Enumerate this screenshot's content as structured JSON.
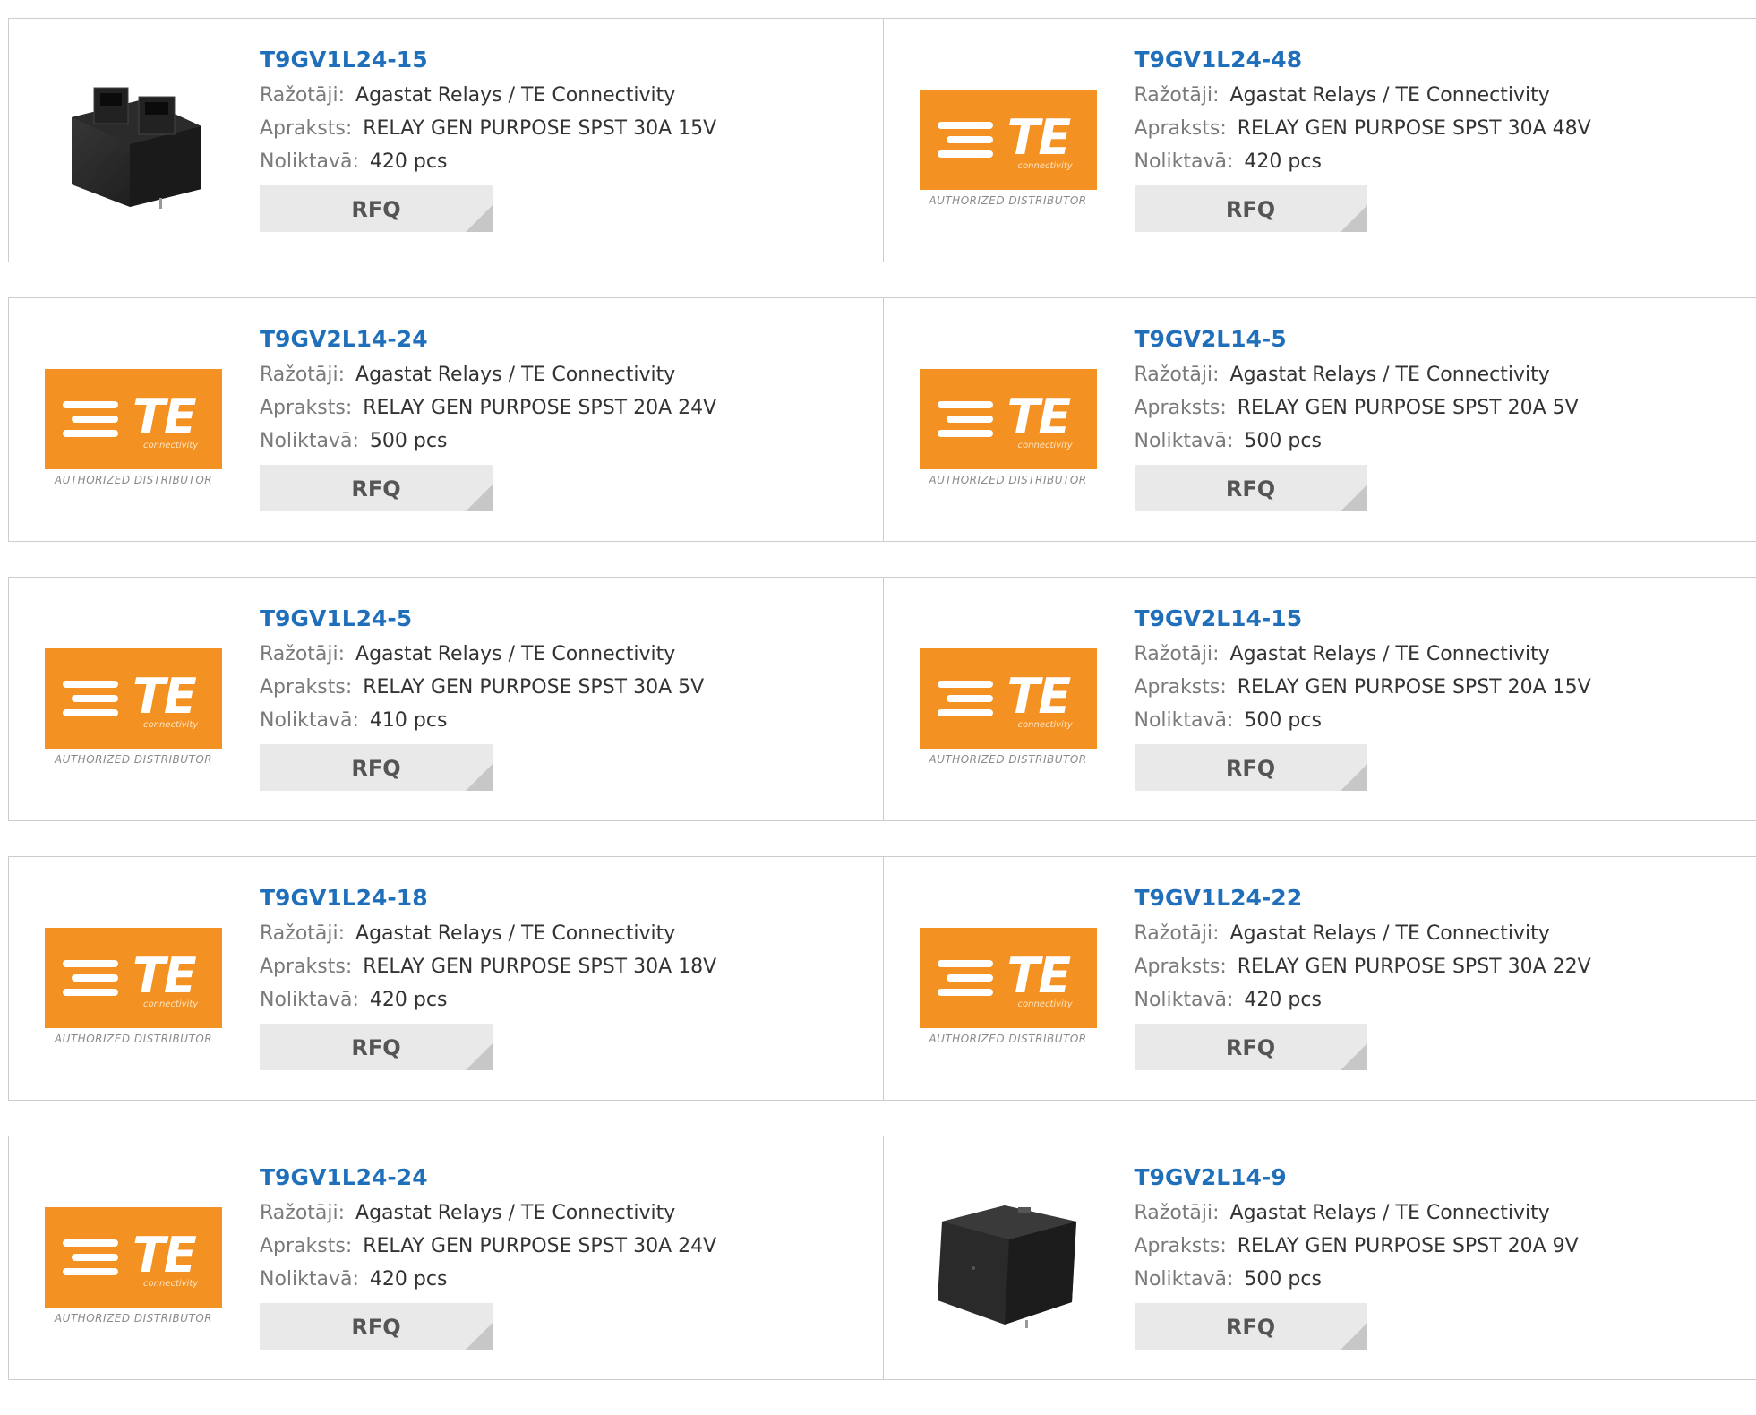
{
  "labels": {
    "manufacturer": "Ražotāji:",
    "description": "Apraksts:",
    "stock": "Noliktavā:",
    "rfq": "RFQ"
  },
  "logo": {
    "wordmark": "TE",
    "tagline": "connectivity",
    "badge": "AUTHORIZED DISTRIBUTOR",
    "accent": "#f39222"
  },
  "colors": {
    "title": "#1f6fba",
    "label": "#7a7a7a",
    "rfq_bg": "#e9e9e9"
  },
  "products": [
    {
      "part": "T9GV1L24-15",
      "manufacturer": "Agastat Relays / TE Connectivity",
      "description": "RELAY GEN PURPOSE SPST 30A 15V",
      "stock": "420 pcs",
      "image": "relay-photo-open"
    },
    {
      "part": "T9GV1L24-48",
      "manufacturer": "Agastat Relays / TE Connectivity",
      "description": "RELAY GEN PURPOSE SPST 30A 48V",
      "stock": "420 pcs",
      "image": "te-logo"
    },
    {
      "part": "T9GV2L14-24",
      "manufacturer": "Agastat Relays / TE Connectivity",
      "description": "RELAY GEN PURPOSE SPST 20A 24V",
      "stock": "500 pcs",
      "image": "te-logo"
    },
    {
      "part": "T9GV2L14-5",
      "manufacturer": "Agastat Relays / TE Connectivity",
      "description": "RELAY GEN PURPOSE SPST 20A 5V",
      "stock": "500 pcs",
      "image": "te-logo"
    },
    {
      "part": "T9GV1L24-5",
      "manufacturer": "Agastat Relays / TE Connectivity",
      "description": "RELAY GEN PURPOSE SPST 30A 5V",
      "stock": "410 pcs",
      "image": "te-logo"
    },
    {
      "part": "T9GV2L14-15",
      "manufacturer": "Agastat Relays / TE Connectivity",
      "description": "RELAY GEN PURPOSE SPST 20A 15V",
      "stock": "500 pcs",
      "image": "te-logo"
    },
    {
      "part": "T9GV1L24-18",
      "manufacturer": "Agastat Relays / TE Connectivity",
      "description": "RELAY GEN PURPOSE SPST 30A 18V",
      "stock": "420 pcs",
      "image": "te-logo"
    },
    {
      "part": "T9GV1L24-22",
      "manufacturer": "Agastat Relays / TE Connectivity",
      "description": "RELAY GEN PURPOSE SPST 30A 22V",
      "stock": "420 pcs",
      "image": "te-logo"
    },
    {
      "part": "T9GV1L24-24",
      "manufacturer": "Agastat Relays / TE Connectivity",
      "description": "RELAY GEN PURPOSE SPST 30A 24V",
      "stock": "420 pcs",
      "image": "te-logo"
    },
    {
      "part": "T9GV2L14-9",
      "manufacturer": "Agastat Relays / TE Connectivity",
      "description": "RELAY GEN PURPOSE SPST 20A 9V",
      "stock": "500 pcs",
      "image": "relay-photo-closed"
    }
  ]
}
